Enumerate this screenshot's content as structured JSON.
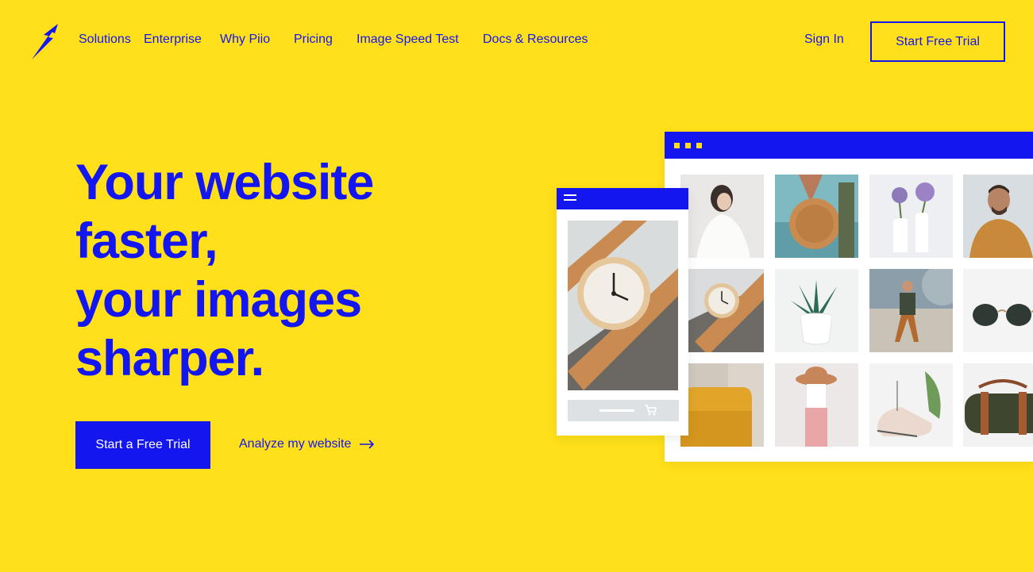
{
  "nav": {
    "logo_icon": "bird-logo-icon",
    "links": [
      "Solutions",
      "Enterprise",
      "Why Piio",
      "Pricing",
      "Image Speed Test",
      "Docs & Resources"
    ],
    "sign_in": "Sign In",
    "trial_button": "Start Free Trial"
  },
  "hero": {
    "title_lines": [
      "Your website",
      "faster,",
      "your images",
      "sharper."
    ],
    "primary_cta": "Start a Free Trial",
    "secondary_cta": "Analyze my website",
    "secondary_icon": "arrow-right-icon"
  },
  "mockup": {
    "browser_dots": 3,
    "grid_images": [
      "woman-white-shirt",
      "rattan-bag",
      "flower-vases",
      "man-mustard-shirt",
      "wooden-watch",
      "succulent-plant",
      "man-sitting",
      "sunglasses",
      "yellow-chair",
      "woman-hat",
      "sneakers",
      "duffel-bag"
    ],
    "mobile_image": "wooden-watch",
    "mobile_menu_icon": "hamburger-menu-icon",
    "mobile_cart_icon": "shopping-cart-icon"
  },
  "colors": {
    "background": "#FFE01B",
    "accent": "#1416F0",
    "white": "#FFFFFF"
  }
}
